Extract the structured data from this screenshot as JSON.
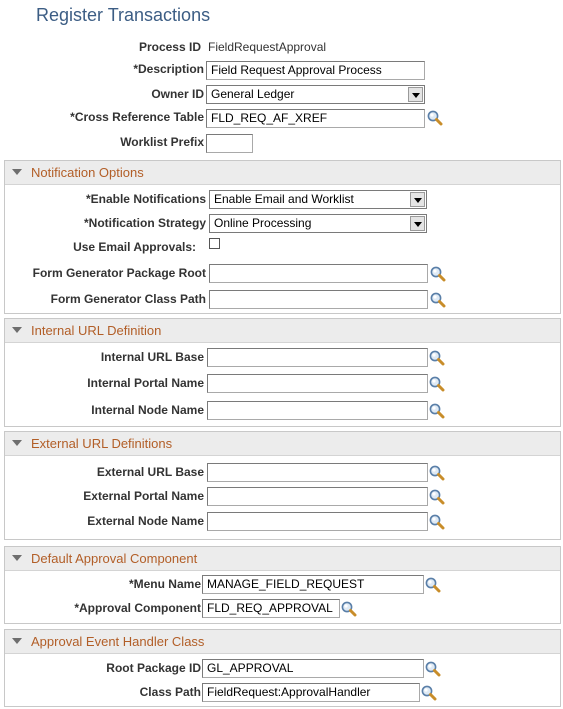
{
  "page": {
    "title": "Register Transactions"
  },
  "header_fields": {
    "process_id": {
      "label": "Process ID",
      "value": "FieldRequestApproval"
    },
    "description": {
      "label": "*Description",
      "value": "Field Request Approval Process"
    },
    "owner_id": {
      "label": "Owner ID",
      "value": "General Ledger"
    },
    "cross_reference_table": {
      "label": "*Cross Reference Table",
      "value": "FLD_REQ_AF_XREF"
    },
    "worklist_prefix": {
      "label": "Worklist Prefix",
      "value": ""
    }
  },
  "notification_options": {
    "title": "Notification Options",
    "enable_notifications": {
      "label": "*Enable Notifications",
      "value": "Enable Email and Worklist"
    },
    "notification_strategy": {
      "label": "*Notification Strategy",
      "value": "Online Processing"
    },
    "use_email_approvals": {
      "label": "Use Email Approvals:",
      "checked": false
    },
    "form_generator_package_root": {
      "label": "Form Generator Package Root",
      "value": ""
    },
    "form_generator_class_path": {
      "label": "Form Generator Class Path",
      "value": ""
    }
  },
  "internal_url": {
    "title": "Internal URL Definition",
    "base": {
      "label": "Internal URL Base",
      "value": ""
    },
    "portal": {
      "label": "Internal Portal Name",
      "value": ""
    },
    "node": {
      "label": "Internal Node Name",
      "value": ""
    }
  },
  "external_url": {
    "title": "External URL Definitions",
    "base": {
      "label": "External URL Base",
      "value": ""
    },
    "portal": {
      "label": "External Portal Name",
      "value": ""
    },
    "node": {
      "label": "External Node Name",
      "value": ""
    }
  },
  "default_approval": {
    "title": "Default Approval Component",
    "menu_name": {
      "label": "*Menu Name",
      "value": "MANAGE_FIELD_REQUEST"
    },
    "approval_component": {
      "label": "*Approval Component",
      "value": "FLD_REQ_APPROVAL"
    }
  },
  "event_handler": {
    "title": "Approval Event Handler Class",
    "root_package": {
      "label": "Root Package ID",
      "value": "GL_APPROVAL"
    },
    "class_path": {
      "label": "Class Path",
      "value": "FieldRequest:ApprovalHandler"
    }
  },
  "colors": {
    "title": "#3c5d84",
    "group_title": "#b25e27",
    "group_header_bg": "#ececec"
  },
  "icons": {
    "lookup": "lookup-magnifier-icon",
    "collapse": "collapse-triangle-icon",
    "dropdown": "chevron-down-icon"
  }
}
